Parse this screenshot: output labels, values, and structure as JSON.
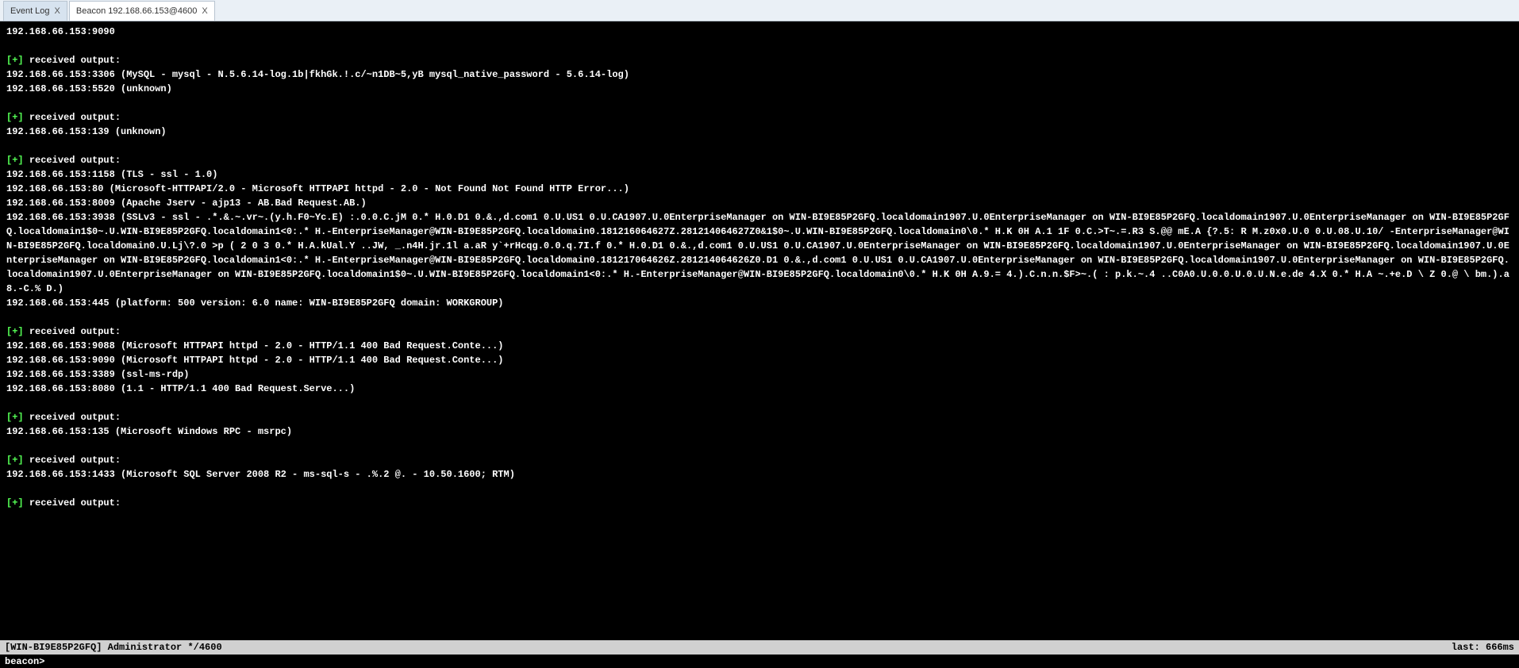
{
  "tabs": {
    "inactive": {
      "label": "Event Log",
      "close": "X"
    },
    "active": {
      "label": "Beacon 192.168.66.153@4600",
      "close": "X"
    }
  },
  "colors": {
    "accent": "#55ff55",
    "console_bg": "#000000",
    "console_fg": "#ffffff"
  },
  "console": {
    "lines": [
      {
        "t": "plain",
        "v": "192.168.66.153:9090"
      },
      {
        "t": "blank"
      },
      {
        "t": "recv",
        "v": "received output:"
      },
      {
        "t": "plain",
        "v": "192.168.66.153:3306 (MySQL - mysql - N.5.6.14-log.1b|fkhGk.!.c/~n1DB~5,yB mysql_native_password - 5.6.14-log)"
      },
      {
        "t": "plain",
        "v": "192.168.66.153:5520 (unknown)"
      },
      {
        "t": "blank"
      },
      {
        "t": "recv",
        "v": "received output:"
      },
      {
        "t": "plain",
        "v": "192.168.66.153:139 (unknown)"
      },
      {
        "t": "blank"
      },
      {
        "t": "recv",
        "v": "received output:"
      },
      {
        "t": "plain",
        "v": "192.168.66.153:1158 (TLS - ssl - 1.0)"
      },
      {
        "t": "plain",
        "v": "192.168.66.153:80 (Microsoft-HTTPAPI/2.0 - Microsoft HTTPAPI httpd - 2.0 - Not Found Not Found HTTP Error...)"
      },
      {
        "t": "plain",
        "v": "192.168.66.153:8009 (Apache Jserv - ajp13 - AB.Bad Request.AB.)"
      },
      {
        "t": "plain",
        "v": "192.168.66.153:3938 (SSLv3 - ssl - .*.&.~.vr~.(y.h.F0~Yc.E) :.0.0.C.jM 0.* H.0.D1 0.&.,d.com1 0.U.US1 0.U.CA1907.U.0EnterpriseManager on WIN-BI9E85P2GFQ.localdomain1907.U.0EnterpriseManager on WIN-BI9E85P2GFQ.localdomain1907.U.0EnterpriseManager on WIN-BI9E85P2GFQ.localdomain1$0~.U.WIN-BI9E85P2GFQ.localdomain1<0:.* H.-EnterpriseManager@WIN-BI9E85P2GFQ.localdomain0.181216064627Z.281214064627Z0&1$0~.U.WIN-BI9E85P2GFQ.localdomain0\\0.* H.K 0H A.1 1F 0.C.>T~.=.R3 S.@@ mE.A {?.5: R M.z0x0.U.0 0.U.08.U.10/ -EnterpriseManager@WIN-BI9E85P2GFQ.localdomain0.U.Lj\\?.0 >p ( 2 0 3 0.* H.A.kUal.Y ..JW, _.n4H.jr.1l a.aR y`+rHcqg.0.0.q.7I.f 0.* H.0.D1 0.&.,d.com1 0.U.US1 0.U.CA1907.U.0EnterpriseManager on WIN-BI9E85P2GFQ.localdomain1907.U.0EnterpriseManager on WIN-BI9E85P2GFQ.localdomain1907.U.0EnterpriseManager on WIN-BI9E85P2GFQ.localdomain1<0:.* H.-EnterpriseManager@WIN-BI9E85P2GFQ.localdomain0.181217064626Z.281214064626Z0.D1 0.&.,d.com1 0.U.US1 0.U.CA1907.U.0EnterpriseManager on WIN-BI9E85P2GFQ.localdomain1907.U.0EnterpriseManager on WIN-BI9E85P2GFQ.localdomain1907.U.0EnterpriseManager on WIN-BI9E85P2GFQ.localdomain1$0~.U.WIN-BI9E85P2GFQ.localdomain1<0:.* H.-EnterpriseManager@WIN-BI9E85P2GFQ.localdomain0\\0.* H.K 0H A.9.= 4.).C.n.n.$F>~.( : p.k.~.4 ..C0A0.U.0.0.U.0.U.N.e.de 4.X 0.* H.A ~.+e.D \\ Z 0.@ \\ bm.).a8.-C.% D.)"
      },
      {
        "t": "plain",
        "v": "192.168.66.153:445 (platform: 500 version: 6.0 name: WIN-BI9E85P2GFQ domain: WORKGROUP)"
      },
      {
        "t": "blank"
      },
      {
        "t": "recv",
        "v": "received output:"
      },
      {
        "t": "plain",
        "v": "192.168.66.153:9088 (Microsoft HTTPAPI httpd - 2.0 - HTTP/1.1 400 Bad Request.Conte...)"
      },
      {
        "t": "plain",
        "v": "192.168.66.153:9090 (Microsoft HTTPAPI httpd - 2.0 - HTTP/1.1 400 Bad Request.Conte...)"
      },
      {
        "t": "plain",
        "v": "192.168.66.153:3389 (ssl-ms-rdp)"
      },
      {
        "t": "plain",
        "v": "192.168.66.153:8080 (1.1 - HTTP/1.1 400 Bad Request.Serve...)"
      },
      {
        "t": "blank"
      },
      {
        "t": "recv",
        "v": "received output:"
      },
      {
        "t": "plain",
        "v": "192.168.66.153:135 (Microsoft Windows RPC - msrpc)"
      },
      {
        "t": "blank"
      },
      {
        "t": "recv",
        "v": "received output:"
      },
      {
        "t": "plain",
        "v": "192.168.66.153:1433 (Microsoft SQL Server 2008 R2 - ms-sql-s - .%.2 @. - 10.50.1600; RTM)"
      },
      {
        "t": "blank"
      },
      {
        "t": "recv",
        "v": "received output:"
      }
    ],
    "recv_prefix": "[+] "
  },
  "status": {
    "left": "[WIN-BI9E85P2GFQ] Administrator */4600",
    "right": "last: 666ms"
  },
  "input": {
    "prompt": "beacon>",
    "value": ""
  }
}
